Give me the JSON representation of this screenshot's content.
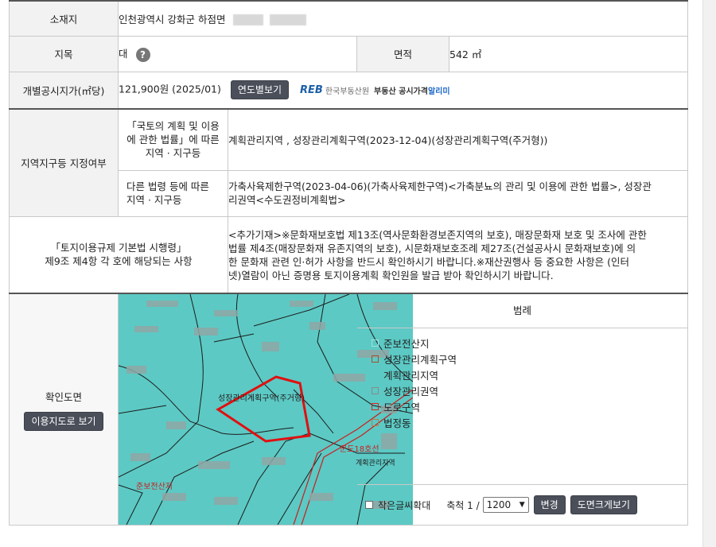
{
  "rows": {
    "location": {
      "label": "소재지",
      "value": "인천광역시 강화군 하점면"
    },
    "jimok": {
      "label": "지목",
      "value": "대",
      "help": "?"
    },
    "area": {
      "label": "면적",
      "value": "542 ㎡"
    },
    "price": {
      "label": "개별공시지가(㎡당)",
      "value": "121,900원 (2025/01)",
      "button": "연도별보기",
      "reb_logo": "REB",
      "reb_org": "한국부동산원",
      "reb_service": "부동산 공시가격",
      "reb_app": "알리미"
    },
    "zoning": {
      "label": "지역지구등 지정여부",
      "sub1_label": [
        "「국토의 계획 및 이용",
        "에 관한 법률」에 따른",
        "지역 · 지구등"
      ],
      "sub1_value": "계획관리지역 , 성장관리계획구역(2023-12-04)(성장관리계획구역(주거형))",
      "sub2_label": [
        "다른 법령 등에 따른",
        "지역 · 지구등"
      ],
      "sub2_value": [
        "가축사육제한구역(2023-04-06)(가축사육제한구역)<가축분뇨의 관리 및 이용에 관한 법률>, 성장관",
        "리권역<수도권정비계획법>"
      ]
    },
    "regulation": {
      "label": [
        "「토지이용규제 기본법 시행령」",
        "제9조 제4항 각 호에 해당되는 사항"
      ],
      "value": [
        "<추가기재>※문화재보호법 제13조(역사문화환경보존지역의 보호), 매장문화재 보호 및 조사에 관한",
        "법률 제4조(매장문화재 유존지역의 보호), 시문화재보호조례 제27조(건설공사시 문화재보호)에 의",
        "한 문화재 관련 인·허가 사항을 반드시 확인하시기 바랍니다.※재산권행사 등 중요한 사항은 (인터",
        "넷)열람이 아닌 증명용 토지이용계획 확인원을 발급 받아 확인하시기 바랍니다."
      ]
    },
    "map": {
      "label": "확인도면",
      "button": "이용지도로 보기"
    }
  },
  "map_labels": {
    "zone": "성장관리계획구역(주거형)",
    "road": "군도18호선",
    "mgmt": "계획관리지역",
    "preserve": "준보전산지"
  },
  "legend": {
    "title": "범례",
    "items": [
      {
        "label": "준보전산지",
        "color": "#9ee3df",
        "fill": false
      },
      {
        "label": "성장관리계획구역",
        "color": "#a0522d",
        "fill": false
      },
      {
        "label": "계획관리지역",
        "color": "#5cc9c4",
        "fill": true
      },
      {
        "label": "성장관리권역",
        "color": "#8a8a8a",
        "fill": false
      },
      {
        "label": "도로구역",
        "color": "#e02020",
        "fill": false
      },
      {
        "label": "법정동",
        "color": "#b08050",
        "fill": false
      }
    ]
  },
  "footer": {
    "small_text_label": "작은글씨확대",
    "scale_label": "축척 1 /",
    "scale_value": "1200",
    "change_button": "변경",
    "large_map_button": "도면크게보기"
  }
}
